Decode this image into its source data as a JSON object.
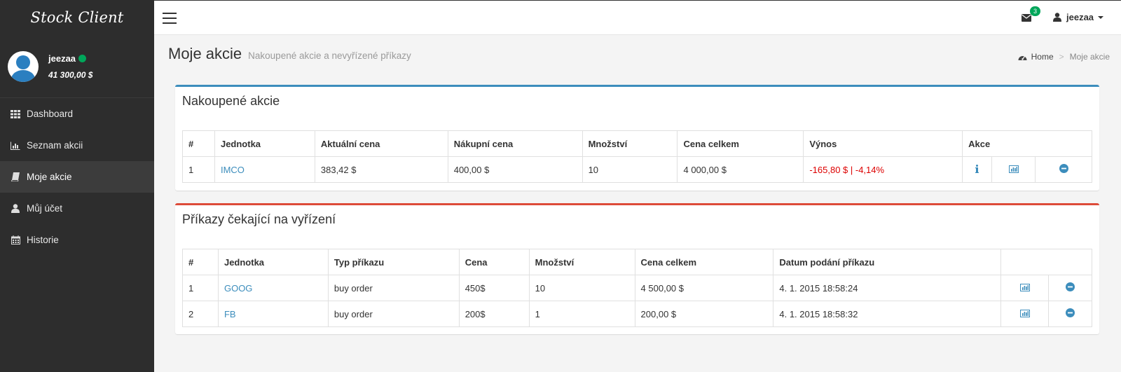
{
  "app": {
    "brand": "Stock Client"
  },
  "user": {
    "name": "jeezaa",
    "balance": "41 300,00 $"
  },
  "sidebar": {
    "items": [
      {
        "label": "Dashboard",
        "icon": "grid-icon"
      },
      {
        "label": "Seznam akcii",
        "icon": "bar-chart-icon"
      },
      {
        "label": "Moje akcie",
        "icon": "book-icon",
        "active": true
      },
      {
        "label": "Můj účet",
        "icon": "user-icon"
      },
      {
        "label": "Historie",
        "icon": "calendar-icon"
      }
    ]
  },
  "topbar": {
    "mail_count": "3",
    "username": "jeezaa"
  },
  "header": {
    "title": "Moje akcie",
    "subtitle": "Nakoupené akcie a nevyřízené příkazy"
  },
  "breadcrumb": {
    "home": "Home",
    "separator": ">",
    "current": "Moje akcie"
  },
  "colors": {
    "primary": "#3c8dbc",
    "danger": "#dd4b39",
    "success": "#00a65a",
    "sidebar": "#2d2d2d",
    "negative": "#dd0000"
  },
  "owned": {
    "title": "Nakoupené akcie",
    "headers": [
      "#",
      "Jednotka",
      "Aktuální cena",
      "Nákupní cena",
      "Množství",
      "Cena celkem",
      "Výnos",
      "Akce"
    ],
    "rows": [
      {
        "num": "1",
        "unit": "IMCO",
        "current": "383,42 $",
        "buy": "400,00 $",
        "qty": "10",
        "total": "4 000,00 $",
        "yield": "-165,80 $ | -4,14%"
      }
    ]
  },
  "pending": {
    "title": "Příkazy čekající na vyřízení",
    "headers": [
      "#",
      "Jednotka",
      "Typ příkazu",
      "Cena",
      "Množství",
      "Cena celkem",
      "Datum podání příkazu",
      ""
    ],
    "rows": [
      {
        "num": "1",
        "unit": "GOOG",
        "type": "buy order",
        "price": "450$",
        "qty": "10",
        "total": "4 500,00 $",
        "date": "4. 1. 2015 18:58:24"
      },
      {
        "num": "2",
        "unit": "FB",
        "type": "buy order",
        "price": "200$",
        "qty": "1",
        "total": "200,00 $",
        "date": "4. 1. 2015 18:58:32"
      }
    ]
  }
}
